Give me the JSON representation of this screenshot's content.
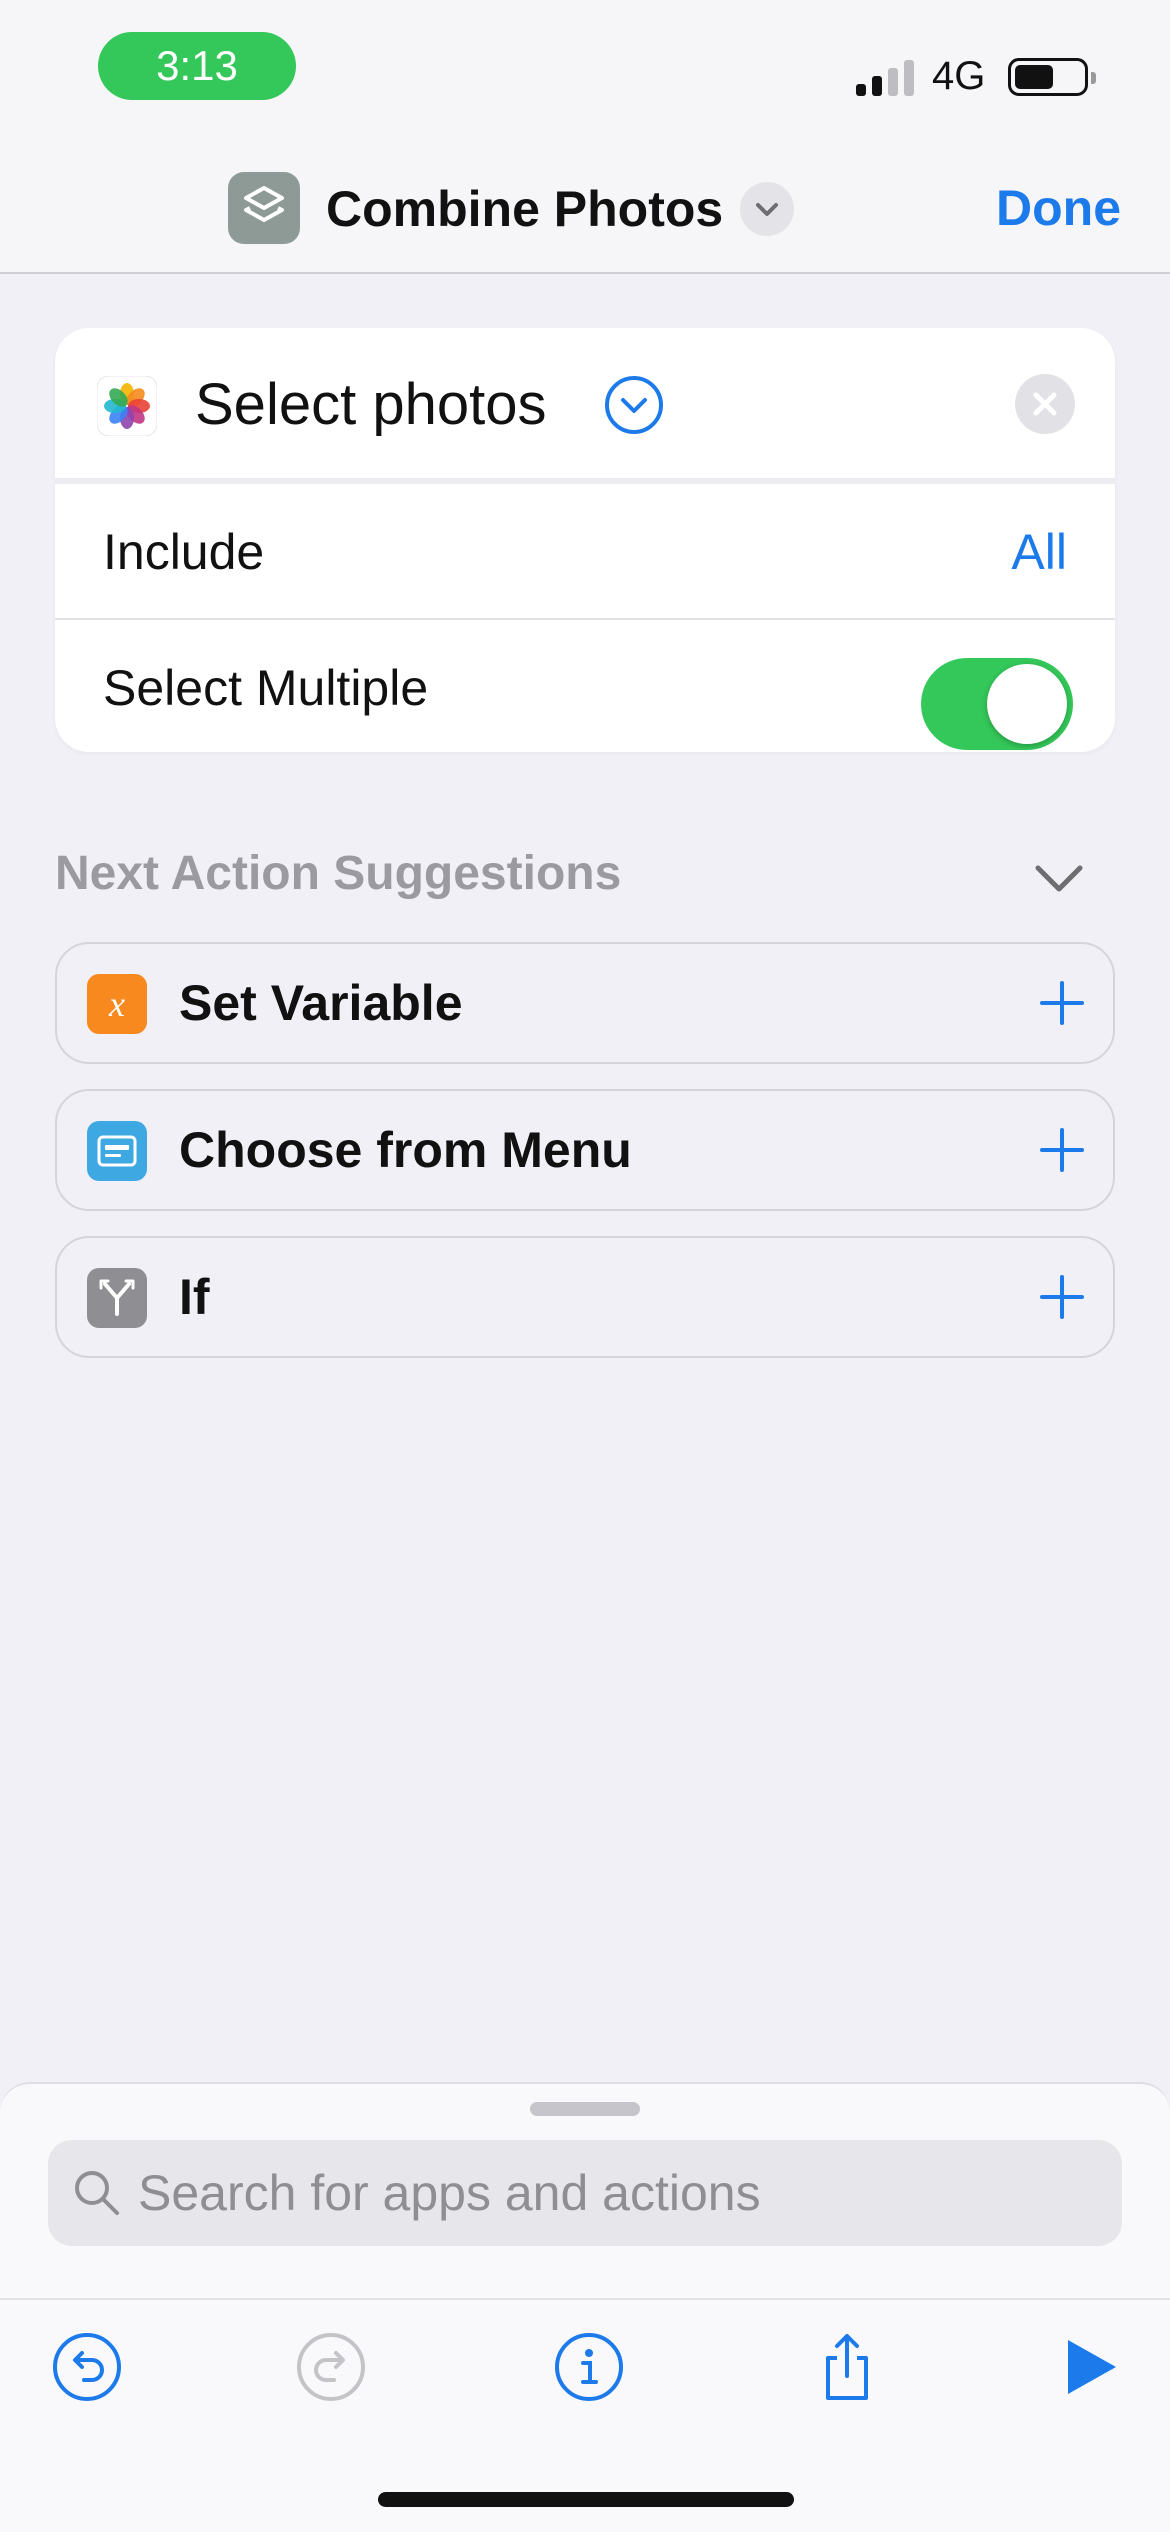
{
  "status_bar": {
    "time": "3:13",
    "network": "4G"
  },
  "nav": {
    "title": "Combine Photos",
    "done_label": "Done"
  },
  "action": {
    "title": "Select photos",
    "rows": [
      {
        "label": "Include",
        "value": "All"
      },
      {
        "label": "Select Multiple",
        "toggle": true
      }
    ]
  },
  "suggestions": {
    "header": "Next Action Suggestions",
    "items": [
      {
        "label": "Set Variable",
        "icon": "variable-icon",
        "color": "#f7891e"
      },
      {
        "label": "Choose from Menu",
        "icon": "menu-icon",
        "color": "#3ea8e2"
      },
      {
        "label": "If",
        "icon": "branch-icon",
        "color": "#8e8e93"
      }
    ]
  },
  "search": {
    "placeholder": "Search for apps and actions",
    "value": ""
  },
  "toolbar": {
    "buttons": [
      {
        "icon": "undo-icon",
        "enabled": true
      },
      {
        "icon": "redo-icon",
        "enabled": false
      },
      {
        "icon": "info-icon",
        "enabled": true
      },
      {
        "icon": "share-icon",
        "enabled": true
      },
      {
        "icon": "play-icon",
        "enabled": true
      }
    ]
  },
  "colors": {
    "accent": "#1c7aea",
    "toggle_on": "#34c759",
    "background": "#f1f0f6"
  }
}
